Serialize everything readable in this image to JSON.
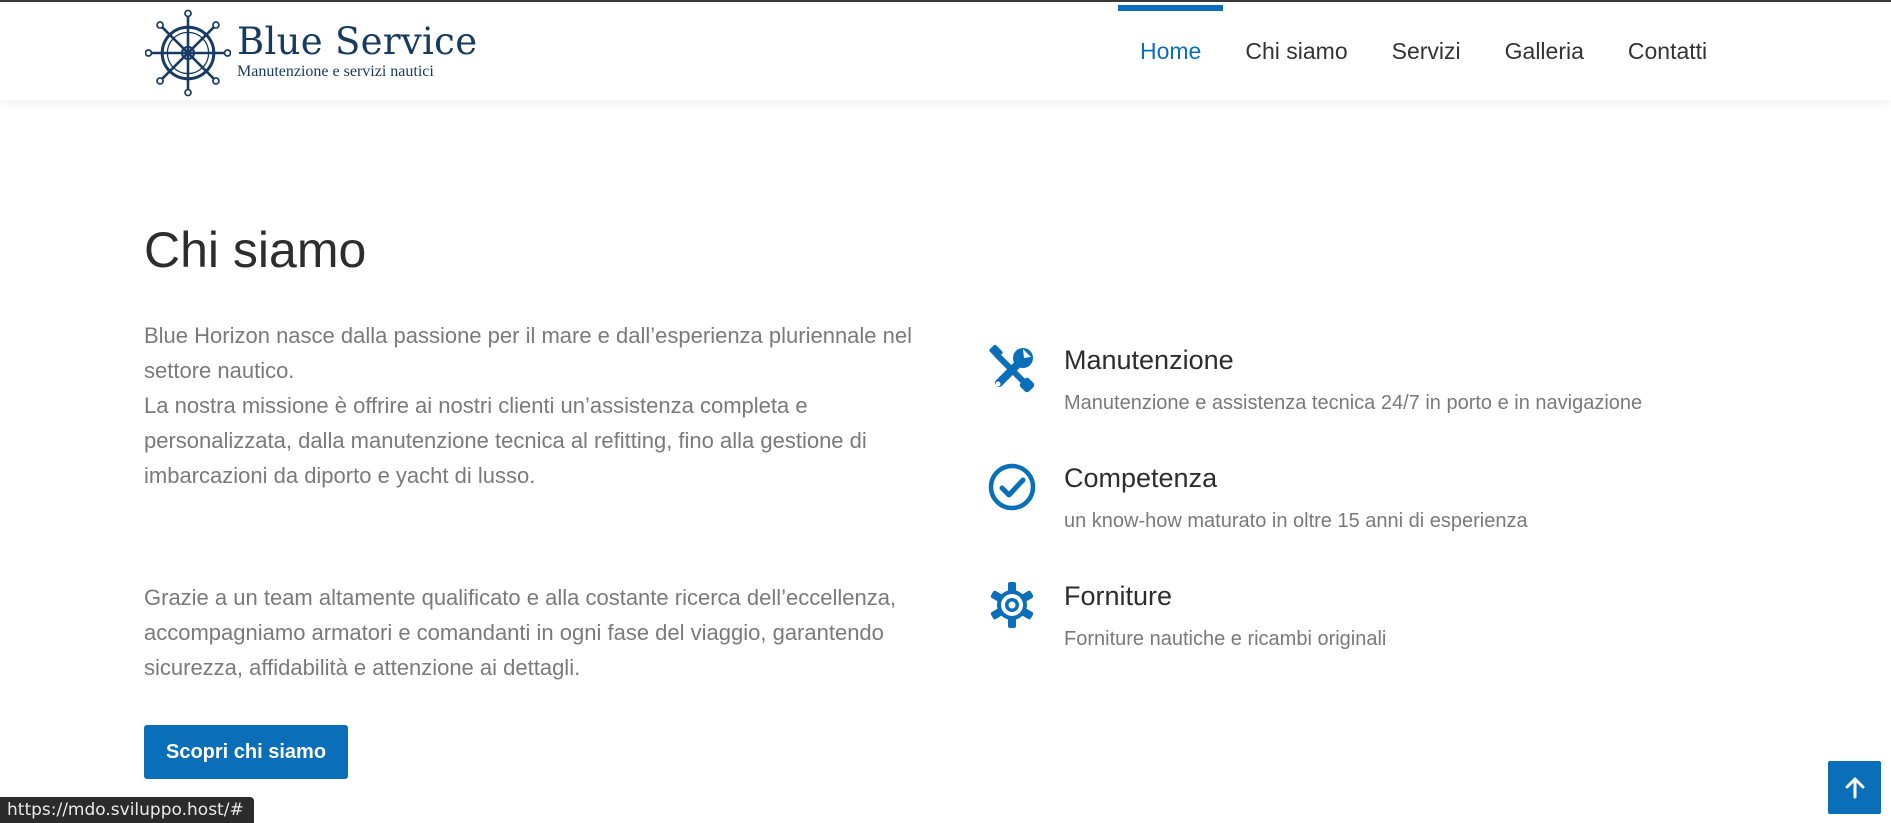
{
  "brand": {
    "title": "Blue Service",
    "subtitle": "Manutenzione e servizi nautici",
    "color": "#173a63",
    "icon": "ship-wheel-icon"
  },
  "nav": {
    "items": [
      {
        "label": "Home",
        "active": true
      },
      {
        "label": "Chi siamo",
        "active": false
      },
      {
        "label": "Servizi",
        "active": false
      },
      {
        "label": "Galleria",
        "active": false
      },
      {
        "label": "Contatti",
        "active": false
      }
    ]
  },
  "about": {
    "title": "Chi siamo",
    "paragraph1": "Blue Horizon nasce dalla passione per il mare e dall’esperienza pluriennale nel settore nautico.\nLa nostra missione è offrire ai nostri clienti un’assistenza completa e personalizzata, dalla manutenzione tecnica al refitting, fino alla gestione di imbarcazioni da diporto e yacht di lusso.",
    "paragraph2": "Grazie a un team altamente qualificato e alla costante ricerca dell’eccellenza, accompagniamo armatori e comandanti in ogni fase del viaggio, garantendo sicurezza, affidabilità e attenzione ai dettagli.",
    "cta_label": "Scopri chi siamo"
  },
  "features": [
    {
      "icon": "tools-icon",
      "title": "Manutenzione",
      "description": "Manutenzione e assistenza tecnica 24/7 in porto e in navigazione"
    },
    {
      "icon": "check-circle-icon",
      "title": "Competenza",
      "description": "un know-how maturato in oltre 15 anni di esperienza"
    },
    {
      "icon": "gear-icon",
      "title": "Forniture",
      "description": "Forniture nautiche e ricambi originali"
    }
  ],
  "scroll_top": {
    "icon": "arrow-up-icon"
  },
  "status_bar": {
    "url": "https://mdo.sviluppo.host/#"
  },
  "colors": {
    "accent": "#0a6fb8",
    "heading": "#2d2d2d",
    "body_text": "#7a7a7a",
    "nav_text": "#333333"
  }
}
